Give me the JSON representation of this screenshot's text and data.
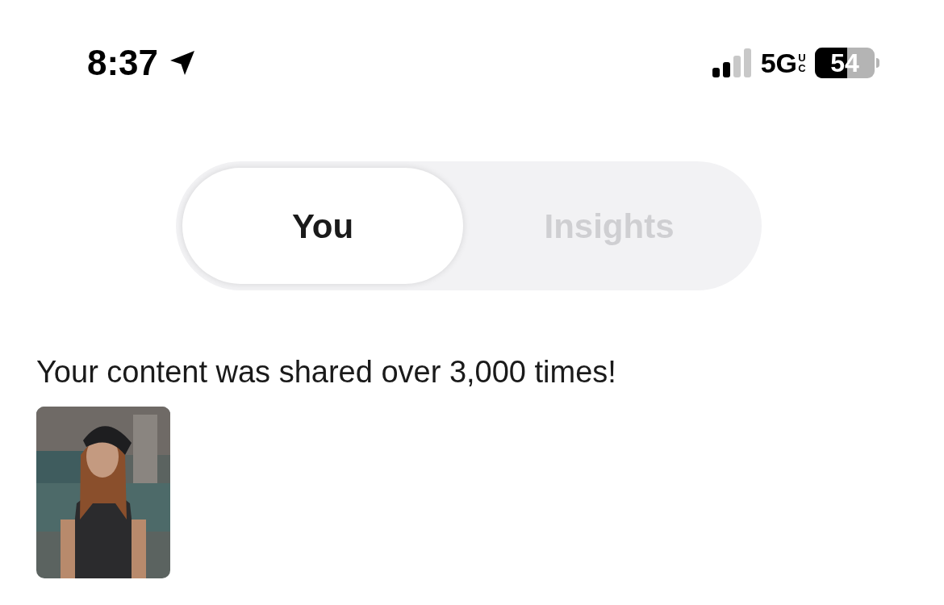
{
  "status_bar": {
    "time": "8:37",
    "network": "5G",
    "network_suffix": "UC",
    "battery": "54"
  },
  "tabs": [
    {
      "label": "You",
      "selected": true
    },
    {
      "label": "Insights",
      "selected": false
    }
  ],
  "message": "Your content was shared over 3,000 times!"
}
